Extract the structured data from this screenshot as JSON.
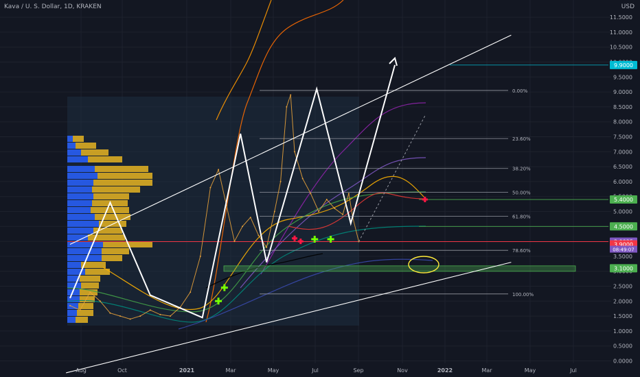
{
  "header": {
    "symbol_line": "Kava / U. S. Dollar, 1D, KRAKEN",
    "currency": "USD"
  },
  "chart_data": {
    "type": "line",
    "title": "Kava / U. S. Dollar, 1D, KRAKEN",
    "xlabel": "",
    "ylabel": "",
    "ylim": [
      0,
      12
    ],
    "grid": true,
    "y_ticks": [
      "0.0000",
      "0.5000",
      "1.0000",
      "1.5000",
      "2.0000",
      "2.5000",
      "3.0000",
      "3.5000",
      "4.0000",
      "4.5000",
      "5.0000",
      "5.5000",
      "6.0000",
      "6.5000",
      "7.0000",
      "7.5000",
      "8.0000",
      "8.5000",
      "9.0000",
      "9.5000",
      "10.0000",
      "10.5000",
      "11.0000",
      "11.5000"
    ],
    "x_ticks": [
      "Aug",
      "Oct",
      "2021",
      "Mar",
      "May",
      "Jul",
      "Sep",
      "Nov",
      "2022",
      "Mar",
      "May",
      "Jul"
    ],
    "fib_levels": [
      {
        "label": "0.00%",
        "value": 9.05
      },
      {
        "label": "23.60%",
        "value": 7.44
      },
      {
        "label": "38.20%",
        "value": 6.44
      },
      {
        "label": "50.00%",
        "value": 5.64
      },
      {
        "label": "61.80%",
        "value": 4.84
      },
      {
        "label": "78.60%",
        "value": 3.7
      },
      {
        "label": "100.00%",
        "value": 2.24
      }
    ],
    "price_tags": [
      {
        "label": "9.9000",
        "value": 9.9,
        "color": "#00bcd4"
      },
      {
        "label": "5.4000",
        "value": 5.4,
        "color": "#4caf50"
      },
      {
        "label": "4.5000",
        "value": 4.5,
        "color": "#4caf50"
      },
      {
        "label": "3.9925",
        "value": 3.99,
        "color": "#7e57c2"
      },
      {
        "label": "3.9000",
        "value": 3.9,
        "color": "#f23645"
      },
      {
        "label": "3.1000",
        "value": 3.1,
        "color": "#4caf50"
      }
    ],
    "countdown": "08:49:07",
    "series": [
      {
        "values": [
          [
            0.0,
            1.85
          ],
          [
            0.5,
            1.7
          ],
          [
            1.0,
            2.3
          ],
          [
            1.5,
            2.0
          ],
          [
            2.0,
            1.6
          ],
          [
            2.5,
            1.5
          ],
          [
            3.0,
            1.4
          ],
          [
            3.5,
            1.5
          ],
          [
            4.0,
            1.7
          ],
          [
            4.5,
            1.55
          ],
          [
            5.0,
            1.5
          ],
          [
            5.5,
            1.8
          ],
          [
            6.0,
            2.3
          ],
          [
            6.5,
            3.5
          ],
          [
            7.0,
            5.8
          ],
          [
            7.4,
            6.4
          ],
          [
            7.8,
            5.2
          ],
          [
            8.2,
            4.0
          ],
          [
            8.6,
            4.5
          ],
          [
            9.0,
            4.8
          ],
          [
            9.4,
            4.2
          ],
          [
            9.8,
            3.8
          ],
          [
            10.2,
            5.0
          ],
          [
            10.5,
            6.0
          ],
          [
            10.8,
            8.5
          ],
          [
            11.0,
            8.9
          ],
          [
            11.2,
            7.0
          ],
          [
            11.6,
            6.1
          ],
          [
            12.0,
            5.6
          ],
          [
            12.4,
            5.0
          ],
          [
            12.8,
            5.4
          ],
          [
            13.2,
            5.1
          ],
          [
            13.6,
            4.9
          ],
          [
            13.9,
            5.6
          ],
          [
            14.1,
            4.8
          ],
          [
            14.4,
            3.99
          ]
        ]
      }
    ],
    "pattern_path": [
      [
        0,
        2.1
      ],
      [
        2.0,
        5.3
      ],
      [
        4.0,
        2.2
      ],
      [
        6.6,
        1.45
      ],
      [
        8.5,
        7.6
      ],
      [
        9.8,
        3.3
      ],
      [
        12.3,
        9.1
      ],
      [
        14.0,
        4.6
      ],
      [
        16.2,
        9.9
      ]
    ],
    "channel": {
      "upper": [
        [
          0,
          3.9
        ],
        [
          22,
          10.9
        ]
      ],
      "lower": [
        [
          -0.2,
          -0.4
        ],
        [
          22,
          3.3
        ]
      ]
    }
  }
}
